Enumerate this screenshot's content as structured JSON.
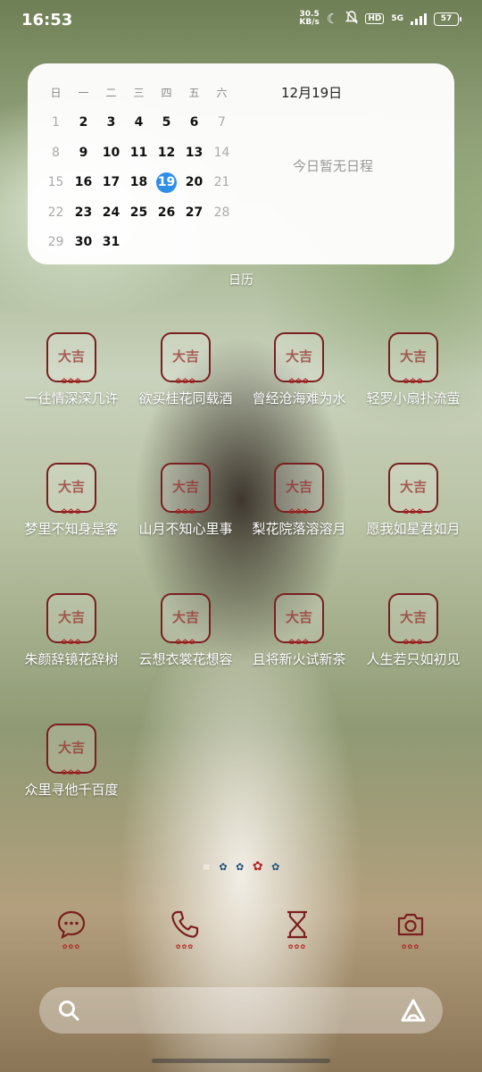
{
  "status_bar": {
    "time": "16:53",
    "net_speed_value": "30.5",
    "net_speed_unit": "KB/s",
    "hd": "HD",
    "network": "5G",
    "battery": "57"
  },
  "calendar": {
    "weekdays": [
      "日",
      "一",
      "二",
      "三",
      "四",
      "五",
      "六"
    ],
    "weeks": [
      [
        "1",
        "2",
        "3",
        "4",
        "5",
        "6",
        "7"
      ],
      [
        "8",
        "9",
        "10",
        "11",
        "12",
        "13",
        "14"
      ],
      [
        "15",
        "16",
        "17",
        "18",
        "19",
        "20",
        "21"
      ],
      [
        "22",
        "23",
        "24",
        "25",
        "26",
        "27",
        "28"
      ],
      [
        "29",
        "30",
        "31",
        "",
        "",
        "",
        ""
      ]
    ],
    "today": "19",
    "date_label": "12月19日",
    "no_events": "今日暂无日程",
    "widget_name": "日历"
  },
  "apps": [
    {
      "label": "一往情深深几许"
    },
    {
      "label": "欲买桂花同载酒"
    },
    {
      "label": "曾经沧海难为水"
    },
    {
      "label": "轻罗小扇扑流萤"
    },
    {
      "label": "梦里不知身是客"
    },
    {
      "label": "山月不知心里事"
    },
    {
      "label": "梨花院落溶溶月"
    },
    {
      "label": "愿我如星君如月"
    },
    {
      "label": "朱颜辞镜花辞树"
    },
    {
      "label": "云想衣裳花想容"
    },
    {
      "label": "且将新火试新茶"
    },
    {
      "label": "人生若只如初见"
    },
    {
      "label": "众里寻他千百度"
    }
  ],
  "app_icon_glyph": "大吉",
  "dock": [
    {
      "name": "messages-icon"
    },
    {
      "name": "phone-icon"
    },
    {
      "name": "hourglass-icon"
    },
    {
      "name": "camera-icon"
    }
  ],
  "colors": {
    "accent_red": "#7a1f1f",
    "today_blue": "#2e8ee8",
    "flower_navy": "#1f4f7a"
  }
}
